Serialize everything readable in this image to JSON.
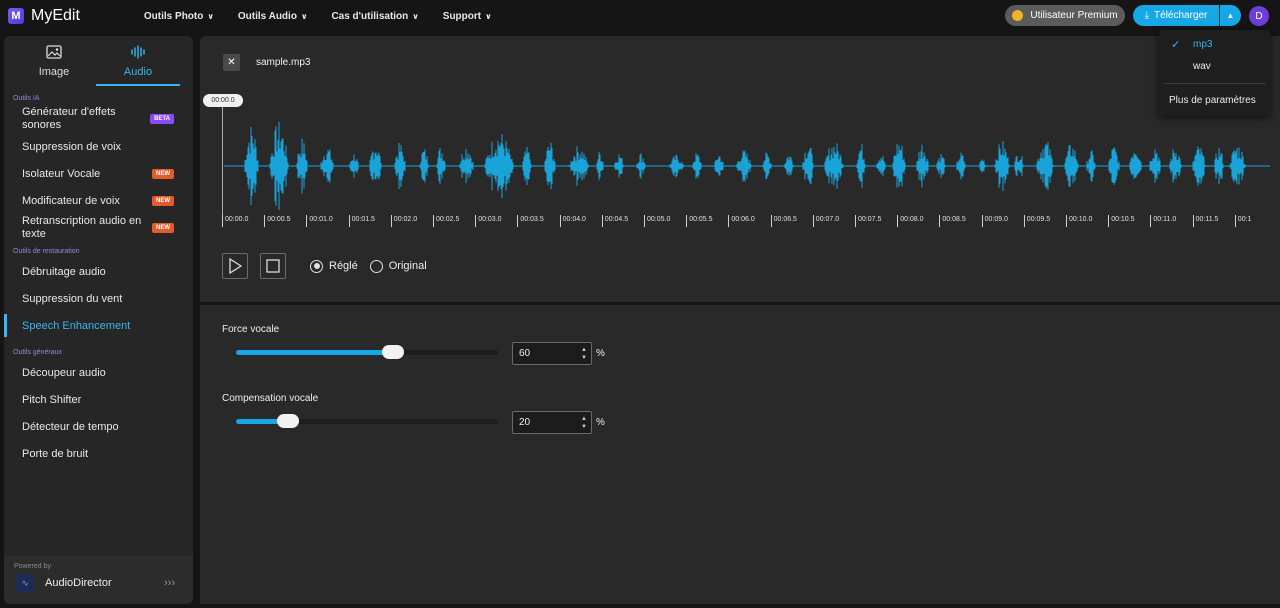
{
  "topbar": {
    "app_name": "MyEdit",
    "logo_letter": "M",
    "nav": [
      {
        "label": "Outils Photo"
      },
      {
        "label": "Outils Audio"
      },
      {
        "label": "Cas d'utilisation"
      },
      {
        "label": "Support"
      }
    ],
    "premium_label": "Utilisateur Premium",
    "download_label": "Télécharger",
    "avatar_letter": "D"
  },
  "sidebar": {
    "tabs": [
      {
        "label": "Image",
        "icon": "image-icon"
      },
      {
        "label": "Audio",
        "icon": "audio-wave-icon",
        "active": true
      }
    ],
    "sections": [
      {
        "label": "Outils IA",
        "items": [
          {
            "label": "Générateur d'effets sonores",
            "badge": "BETA"
          },
          {
            "label": "Suppression de voix"
          },
          {
            "label": "Isolateur Vocale",
            "badge": "NEW"
          },
          {
            "label": "Modificateur de voix",
            "badge": "NEW"
          },
          {
            "label": "Retranscription audio en texte",
            "badge": "NEW"
          }
        ]
      },
      {
        "label": "Outils de restauration",
        "items": [
          {
            "label": "Débruitage audio"
          },
          {
            "label": "Suppression du vent"
          },
          {
            "label": "Speech Enhancement",
            "active": true
          }
        ]
      },
      {
        "label": "Outils généraux",
        "items": [
          {
            "label": "Découpeur audio"
          },
          {
            "label": "Pitch Shifter"
          },
          {
            "label": "Détecteur de tempo"
          },
          {
            "label": "Porte de bruit"
          }
        ]
      }
    ],
    "powered_by_label": "Powered by",
    "powered_by_name": "AudioDirector"
  },
  "editor": {
    "file_name": "sample.mp3",
    "playhead_time": "00:00.0",
    "timeline_labels": [
      "00:00.0",
      "00:00.5",
      "00:01.0",
      "00:01.5",
      "00:02.0",
      "00:02.5",
      "00:03.0",
      "00:03.5",
      "00:04.0",
      "00:04.5",
      "00:05.0",
      "00:05.5",
      "00:06.0",
      "00:06.5",
      "00:07.0",
      "00:07.5",
      "00:08.0",
      "00:08.5",
      "00:09.0",
      "00:09.5",
      "00:10.0",
      "00:10.5",
      "00:11.0",
      "00:11.5",
      "00:1"
    ],
    "waveform_color": "#1aa3d9",
    "playback_options": [
      {
        "label": "Réglé",
        "selected": true
      },
      {
        "label": "Original",
        "selected": false
      }
    ]
  },
  "params": {
    "voice_strength": {
      "label": "Force vocale",
      "value": "60",
      "unit": "%",
      "fraction": 0.6
    },
    "voice_compensation": {
      "label": "Compensation vocale",
      "value": "20",
      "unit": "%",
      "fraction": 0.2
    }
  },
  "download_menu": {
    "formats": [
      {
        "label": "mp3",
        "selected": true
      },
      {
        "label": "wav",
        "selected": false
      }
    ],
    "more_label": "Plus de paramètres"
  },
  "colors": {
    "accent": "#15a7e6",
    "beta_badge": "#8a4bff",
    "new_badge": "#e35a2b",
    "avatar": "#6b3fd8",
    "premium_coin": "#f0b429"
  }
}
